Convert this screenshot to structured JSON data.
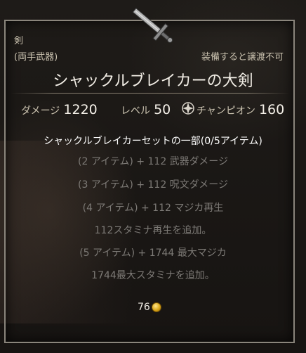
{
  "item": {
    "category": "剣",
    "weapon_type": "(両手武器)",
    "bind_status": "装備すると譲渡不可",
    "name": "シャックルブレイカーの大剣"
  },
  "stats": {
    "damage_label": "ダメージ",
    "damage_value": "1220",
    "level_label": "レベル",
    "level_value": "50",
    "champion_label": "チャンピオン",
    "champion_value": "160"
  },
  "set": {
    "title": "シャックルブレイカーセットの一部(0/5アイテム)",
    "bonuses": [
      "(2 アイテム) + 112 武器ダメージ",
      "(3 アイテム) + 112 呪文ダメージ",
      "(4 アイテム) + 112 マジカ再生",
      "112スタミナ再生を追加。",
      "(5 アイテム) + 1744 最大マジカ",
      "1744最大スタミナを追加。"
    ]
  },
  "value": {
    "gold": "76",
    "currency_icon": "gold-coin-icon"
  },
  "colors": {
    "name_text": "#f1ede5",
    "inactive_bonus": "#7d7a76",
    "frame": "#8a857c",
    "gold": "#d9a619"
  }
}
